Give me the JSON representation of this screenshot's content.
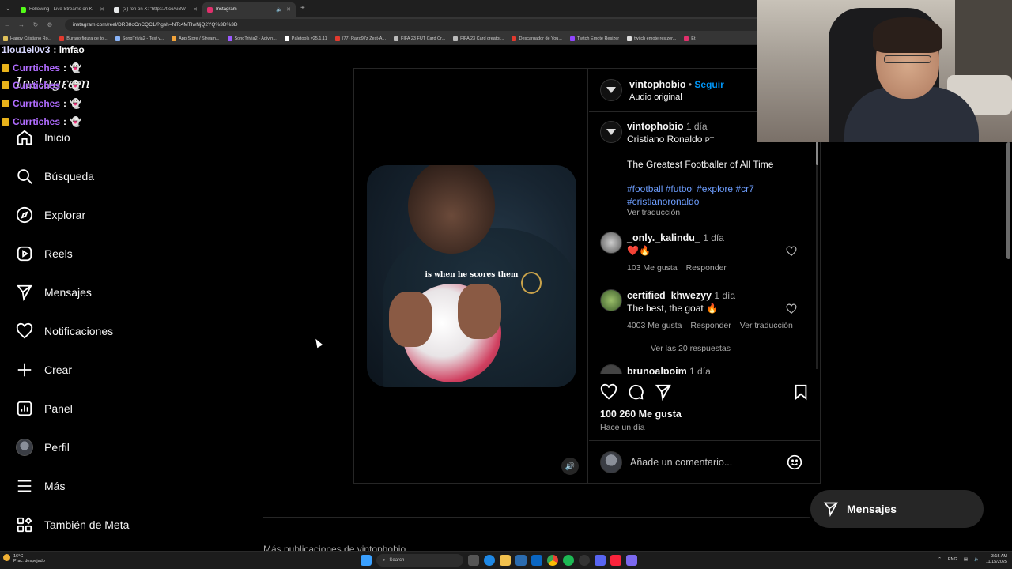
{
  "browser": {
    "tabs": [
      {
        "label": "Following - Live Streams on Ki",
        "color": "#53fc18"
      },
      {
        "label": "(3) fon on X: \"https://t.co/G3W",
        "color": "#e7e9ea"
      },
      {
        "label": "Instagram",
        "color": "#e1306c"
      }
    ],
    "url": "instagram.com/reel/DRB8oCnCQC1/?igsh=NTc4MTIwNjQ2YQ%3D%3D",
    "bookmarks": [
      {
        "label": "Happy Cristiano Ro...",
        "color": "#e0c15a"
      },
      {
        "label": "Burago figura de to...",
        "color": "#e23a2e"
      },
      {
        "label": "SongTrivia2 - Test y...",
        "color": "#8ab4f8"
      },
      {
        "label": "App Store / Stream...",
        "color": "#f2a33a"
      },
      {
        "label": "SongTrivia2 - Adivin...",
        "color": "#9b59ff"
      },
      {
        "label": "Paletools v25.1.11",
        "color": "#ffffff"
      },
      {
        "label": "(77) Razo97z Zest-A...",
        "color": "#e23a2e"
      },
      {
        "label": "FIFA 23 FUT Card Cr...",
        "color": "#bbbbbb"
      },
      {
        "label": "FIFA 23 Card creator...",
        "color": "#bbbbbb"
      },
      {
        "label": "Descargador de You...",
        "color": "#e23a2e"
      },
      {
        "label": "Twitch Emote Resizer",
        "color": "#9146ff"
      },
      {
        "label": "twitch emote resizer...",
        "color": "#dddddd"
      },
      {
        "label": "Et",
        "color": "#e1306c"
      }
    ]
  },
  "chat": [
    {
      "user": "1lou1el0v3",
      "msg": ": lmfao"
    },
    {
      "user": "Currtiches",
      "msg": ":"
    },
    {
      "user": "Currtiches",
      "msg": ":"
    },
    {
      "user": "Currtiches",
      "msg": ":"
    },
    {
      "user": "Currtiches",
      "msg": ":"
    }
  ],
  "sidebar": {
    "logo": "Instagram",
    "items": [
      {
        "label": "Inicio",
        "icon": "home-icon"
      },
      {
        "label": "Búsqueda",
        "icon": "search-icon"
      },
      {
        "label": "Explorar",
        "icon": "compass-icon"
      },
      {
        "label": "Reels",
        "icon": "reels-icon"
      },
      {
        "label": "Mensajes",
        "icon": "paper-plane-icon"
      },
      {
        "label": "Notificaciones",
        "icon": "heart-icon"
      },
      {
        "label": "Crear",
        "icon": "plus-icon"
      },
      {
        "label": "Panel",
        "icon": "chart-icon"
      },
      {
        "label": "Perfil",
        "icon": "avatar-icon"
      },
      {
        "label": "Más",
        "icon": "menu-icon"
      },
      {
        "label": "También de Meta",
        "icon": "meta-grid-icon"
      }
    ]
  },
  "post": {
    "video_caption": "is when he scores them",
    "header": {
      "username": "vintophobio",
      "follow": "Seguir",
      "audio": "Audio original"
    },
    "caption": {
      "username": "vintophobio",
      "time": "1 día",
      "tag": "Cristiano Ronaldo",
      "tag_suffix": "PT",
      "text": "The Greatest Footballer of All Time",
      "hashtags_line1": "#football #futbol #explore #cr7",
      "hashtags_line2": "#cristianoronaldo",
      "translate": "Ver traducción"
    },
    "comments": [
      {
        "username": "_only._kalindu_",
        "time": "1 día",
        "text": "❤️🔥",
        "likes": "103 Me gusta",
        "reply": "Responder",
        "translate": ""
      },
      {
        "username": "certified_khwezyy",
        "time": "1 día",
        "text": "The best, the goat 🔥",
        "likes": "4003 Me gusta",
        "reply": "Responder",
        "translate": "Ver traducción"
      }
    ],
    "view_replies": "Ver las 20 respuestas",
    "partial_comment": {
      "username": "brunoalpoim",
      "time": "1 día"
    },
    "likes": "100 260 Me gusta",
    "posted": "Hace un día",
    "comment_placeholder": "Añade un comentario...",
    "more_from": "Más publicaciones de vintophobio"
  },
  "floating": {
    "messages_label": "Mensajes"
  },
  "taskbar": {
    "temp": "16°C",
    "weather": "Prac. despejado",
    "search": "Search",
    "lang": "ENG",
    "time": "3:15 AM",
    "date": "11/15/2025"
  }
}
